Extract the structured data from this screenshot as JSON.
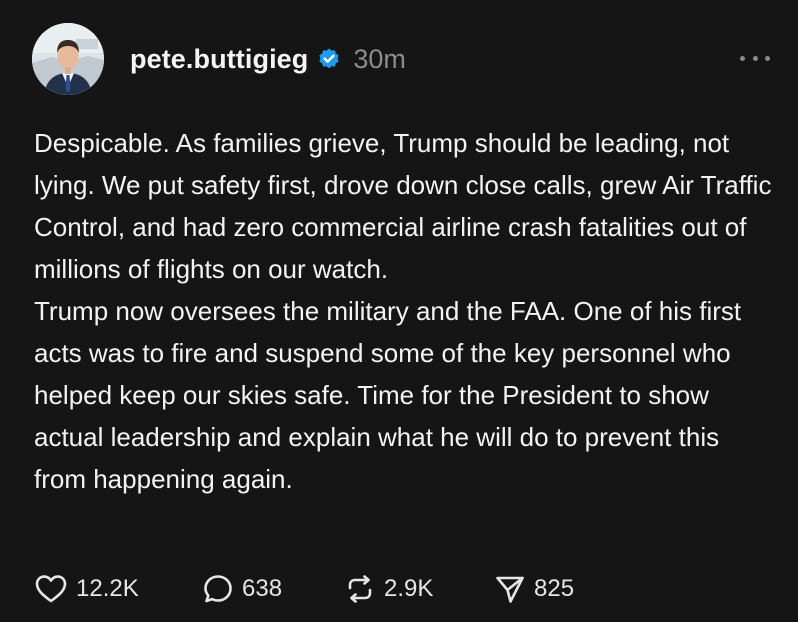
{
  "post": {
    "author": {
      "username": "pete.buttigieg",
      "verified": true,
      "timestamp": "30m",
      "avatar_icon": "profile-photo"
    },
    "body": [
      "Despicable. As families grieve, Trump should be leading, not lying. We put safety first, drove down close calls, grew Air Traffic Control, and had zero commercial airline crash fatalities out of millions of flights on our watch.",
      "Trump now oversees the military and the FAA. One of his first acts was to fire and suspend some of the key personnel who helped keep our skies safe. Time for the President to show actual leadership and explain what he will do to prevent this from happening again."
    ],
    "actions": {
      "likes": "12.2K",
      "replies": "638",
      "reposts": "2.9K",
      "shares": "825"
    },
    "icons": {
      "like": "heart-icon",
      "reply": "speech-bubble-icon",
      "repost": "repost-icon",
      "share": "paper-plane-icon",
      "more": "more-dots-icon",
      "verified": "verified-badge-icon"
    }
  },
  "colors": {
    "background": "#151515",
    "text": "#f3f3f3",
    "muted": "#8b8b8b",
    "verified_badge": "#1d9bf0"
  }
}
